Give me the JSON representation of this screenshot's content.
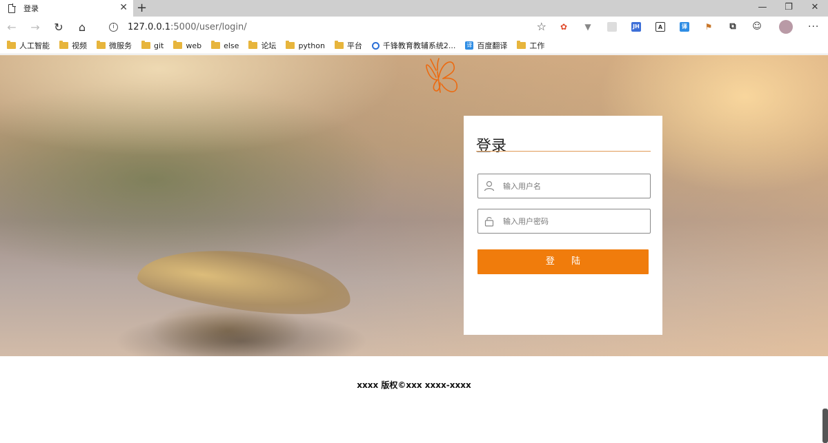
{
  "browser": {
    "tab_title": "登录",
    "tab_close": "✕",
    "new_tab": "+",
    "window_controls": [
      "—",
      "❐",
      "✕"
    ],
    "url_host": "127.0.0.1",
    "url_rest": ":5000/user/login/",
    "bookmarks": [
      {
        "label": "人工智能",
        "icon": "folder-icon"
      },
      {
        "label": "视频",
        "icon": "folder-icon"
      },
      {
        "label": "微服务",
        "icon": "folder-icon"
      },
      {
        "label": "git",
        "icon": "folder-icon"
      },
      {
        "label": "web",
        "icon": "folder-icon"
      },
      {
        "label": "else",
        "icon": "folder-icon"
      },
      {
        "label": "论坛",
        "icon": "folder-icon"
      },
      {
        "label": "python",
        "icon": "folder-icon"
      },
      {
        "label": "平台",
        "icon": "folder-icon"
      },
      {
        "label": "千锋教育教辅系统2...",
        "icon": "site-icon"
      },
      {
        "label": "百度翻译",
        "icon": "translate-icon"
      },
      {
        "label": "工作",
        "icon": "folder-icon"
      }
    ],
    "extensions": [
      "extension-red-icon",
      "extension-v-icon",
      "extension-grey-icon",
      "extension-jh-icon",
      "extension-a-icon",
      "extension-translate-icon",
      "extension-stamp-icon",
      "collections-icon",
      "feedback-icon"
    ]
  },
  "login": {
    "title": "登录",
    "username_placeholder": "输入用户名",
    "password_placeholder": "输入用户密码",
    "submit_label": "登 陆"
  },
  "footer": {
    "copyright": "xxxx 版权©xxx xxxx-xxxx"
  },
  "colors": {
    "accent": "#f07c0c",
    "title_rule": "#e09a55"
  }
}
